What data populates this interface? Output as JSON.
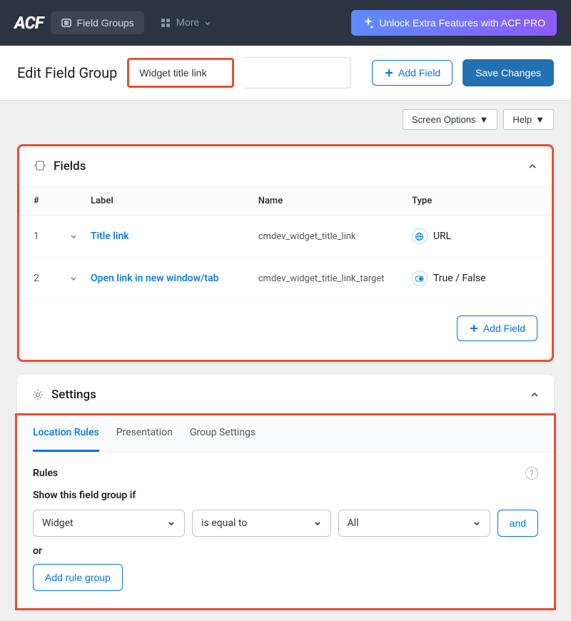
{
  "nav": {
    "logo": "ACF",
    "field_groups": "Field Groups",
    "more": "More",
    "pro": "Unlock Extra Features with ACF PRO"
  },
  "header": {
    "page_title": "Edit Field Group",
    "group_title_value": "Widget title link",
    "add_field": "Add Field",
    "save": "Save Changes"
  },
  "meta": {
    "screen_options": "Screen Options",
    "help": "Help"
  },
  "fields_panel": {
    "title": "Fields",
    "cols": {
      "num": "#",
      "label": "Label",
      "name": "Name",
      "type": "Type"
    },
    "rows": [
      {
        "num": "1",
        "label": "Title link",
        "name": "cmdev_widget_title_link",
        "type": "URL",
        "icon": "globe"
      },
      {
        "num": "2",
        "label": "Open link in new window/tab",
        "name": "cmdev_widget_title_link_target",
        "type": "True / False",
        "icon": "toggle"
      }
    ],
    "add_field": "Add Field"
  },
  "settings_panel": {
    "title": "Settings",
    "tabs": {
      "location": "Location Rules",
      "presentation": "Presentation",
      "group": "Group Settings"
    },
    "rules_title": "Rules",
    "rules_desc": "Show this field group if",
    "rule": {
      "param": "Widget",
      "operator": "is equal to",
      "value": "All",
      "and": "and"
    },
    "or": "or",
    "add_rule_group": "Add rule group"
  }
}
